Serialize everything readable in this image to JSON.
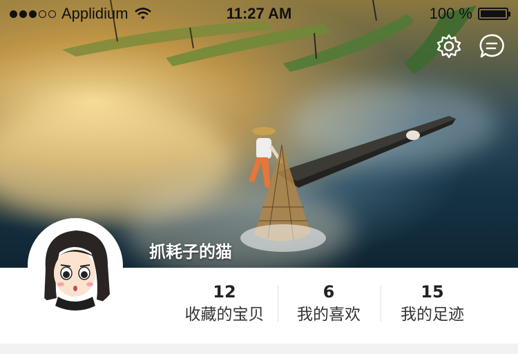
{
  "status_bar": {
    "carrier": "Applidium",
    "time": "11:27 AM",
    "battery": "100 %",
    "signal_filled": 3,
    "signal_total": 5
  },
  "icons": {
    "settings": "gear-icon",
    "messages": "chat-bubble-icon"
  },
  "profile": {
    "username": "抓耗子的猫"
  },
  "stats": [
    {
      "value": "12",
      "label": "收藏的宝贝"
    },
    {
      "value": "6",
      "label": "我的喜欢"
    },
    {
      "value": "15",
      "label": "我的足迹"
    }
  ],
  "colors": {
    "hero_warm": "#e6aa46",
    "hero_water": "#163446",
    "card_bg": "#ffffff"
  }
}
